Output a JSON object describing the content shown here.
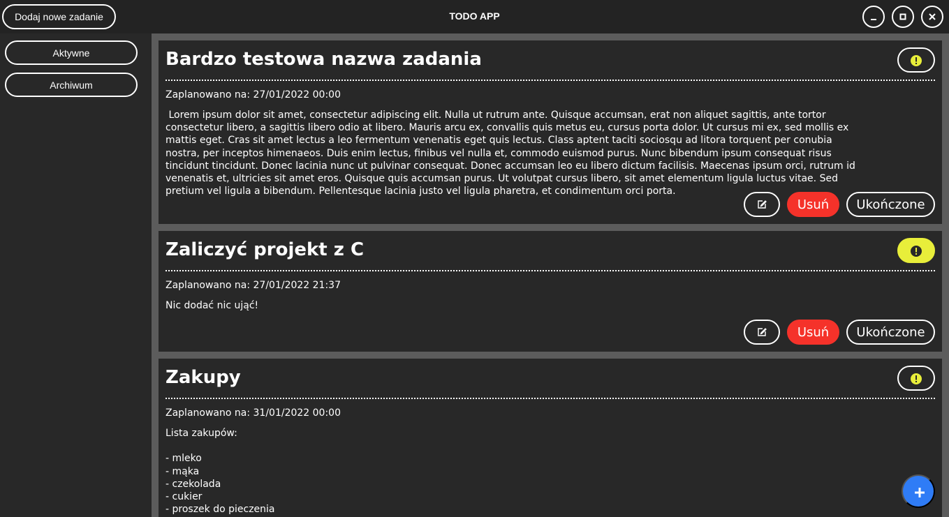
{
  "app": {
    "title": "TODO APP"
  },
  "toolbar": {
    "add_label": "Dodaj nowe zadanie"
  },
  "window_controls": [
    "minimize-icon",
    "maximize-icon",
    "close-icon"
  ],
  "sidebar": {
    "items": [
      {
        "label": "Aktywne"
      },
      {
        "label": "Archiwum"
      }
    ]
  },
  "tasks": [
    {
      "title": "Bardzo testowa nazwa zadania",
      "date": "Zaplanowano na: 27/01/2022 00:00",
      "description": " Lorem ipsum dolor sit amet, consectetur adipiscing elit. Nulla ut rutrum ante. Quisque accumsan, erat non aliquet sagittis, ante tortor consectetur libero, a sagittis libero odio at libero. Mauris arcu ex, convallis quis metus eu, cursus porta dolor. Ut cursus mi ex, sed mollis ex mattis eget. Cras sit amet lectus a leo fermentum venenatis eget quis lectus. Class aptent taciti sociosqu ad litora torquent per conubia nostra, per inceptos himenaeos. Duis enim lectus, finibus vel nulla et, commodo euismod purus. Nunc bibendum ipsum consequat risus tincidunt tincidunt. Donec lacinia nunc ut pulvinar consequat. Donec accumsan leo eu libero dictum facilisis. Maecenas ipsum orci, rutrum id venenatis et, ultricies sit amet eros. Quisque quis accumsan purus. Ut volutpat cursus libero, sit amet elementum ligula luctus vitae. Sed pretium vel ligula a bibendum. Pellentesque lacinia justo vel ligula pharetra, et condimentum orci porta.",
      "important": false,
      "delete_label": "Usuń",
      "done_label": "Ukończone"
    },
    {
      "title": "Zaliczyć projekt z C",
      "date": "Zaplanowano na: 27/01/2022 21:37",
      "description": "Nic dodać nic ująć!",
      "important": true,
      "delete_label": "Usuń",
      "done_label": "Ukończone"
    },
    {
      "title": "Zakupy",
      "date": "Zaplanowano na: 31/01/2022 00:00",
      "description": "Lista zakupów:\n\n- mleko\n- mąka\n- czekolada\n- cukier\n- proszek do pieczenia",
      "important": false
    }
  ],
  "colors": {
    "background": "#282828",
    "titlebar": "#232323",
    "scroll_area": "#5c5c5c",
    "delete": "#f5322a",
    "priority": "#e8ee3a",
    "fab": "#2f7cf6"
  }
}
